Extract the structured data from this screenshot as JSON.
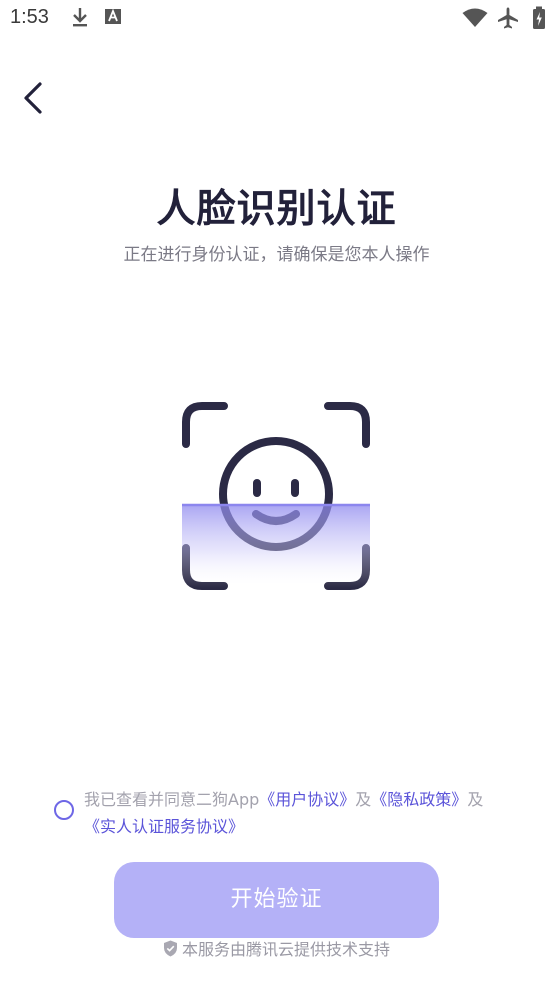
{
  "status_bar": {
    "time": "1:53",
    "icons": [
      "download-icon",
      "text-icon",
      "wifi-icon",
      "airplane-icon",
      "battery-icon"
    ]
  },
  "header": {
    "back_icon": "chevron-left-icon"
  },
  "main": {
    "title": "人脸识别认证",
    "subtitle": "正在进行身份认证，请确保是您本人操作",
    "illustration_icon": "face-scan-icon"
  },
  "agreement": {
    "prefix": "我已查看并同意二狗App",
    "link_user": "《用户协议》",
    "and1": "及",
    "link_privacy": "《隐私政策》",
    "and2": "及",
    "link_realname": "《实人认证服务协议》"
  },
  "actions": {
    "start_label": "开始验证"
  },
  "footer": {
    "note": "本服务由腾讯云提供技术支持",
    "shield_icon": "shield-check-icon"
  },
  "colors": {
    "accent": "#6e67e6",
    "button_bg": "#b4b1f7",
    "title": "#22213a"
  }
}
